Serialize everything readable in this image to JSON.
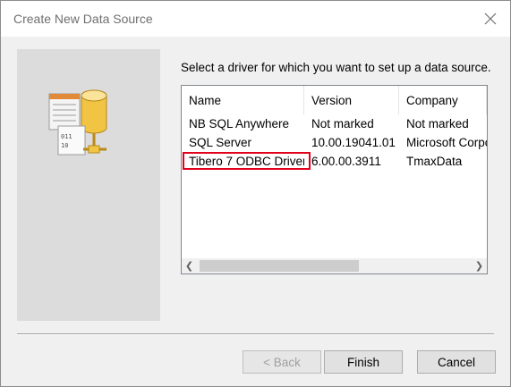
{
  "window": {
    "title": "Create New Data Source",
    "close_icon": "close-icon"
  },
  "prompt": "Select a driver for which you want to set up a data source.",
  "list": {
    "columns": [
      "Name",
      "Version",
      "Company"
    ],
    "rows": [
      {
        "name": "NB SQL Anywhere",
        "version": "Not marked",
        "company": "Not marked"
      },
      {
        "name": "SQL Server",
        "version": "10.00.19041.01",
        "company": "Microsoft Corpo"
      },
      {
        "name": "Tibero 7 ODBC Driver",
        "version": "6.00.00.3911",
        "company": "TmaxData"
      }
    ],
    "highlighted_row": 2,
    "highlight_color": "#e0001b"
  },
  "buttons": {
    "back": "< Back",
    "finish": "Finish",
    "cancel": "Cancel"
  }
}
